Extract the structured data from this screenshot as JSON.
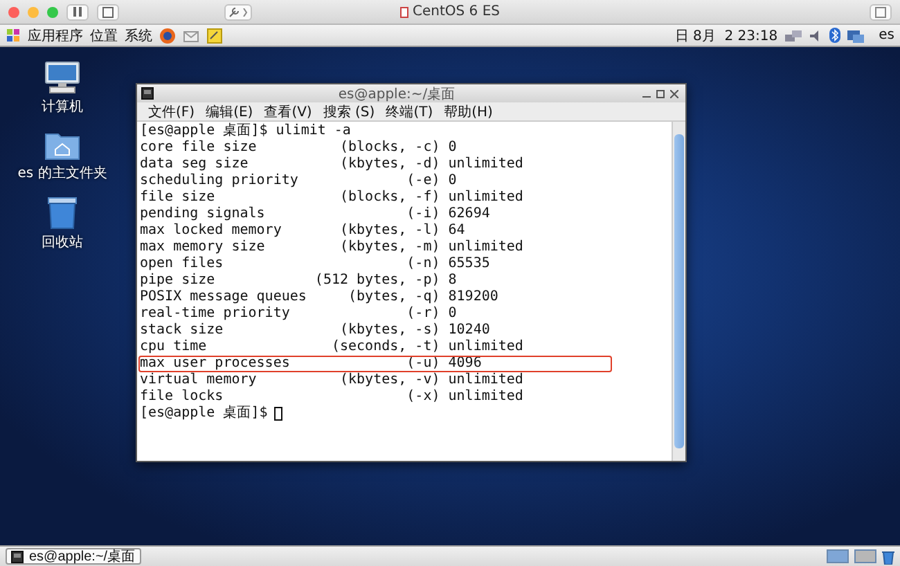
{
  "host_window": {
    "title": "CentOS 6 ES"
  },
  "top_panel": {
    "menus": [
      "应用程序",
      "位置",
      "系统"
    ],
    "clock": "日 8月  2 23:18",
    "user": "es"
  },
  "desktop_icons": [
    {
      "kind": "computer",
      "label": "计算机"
    },
    {
      "kind": "home",
      "label": "es 的主文件夹"
    },
    {
      "kind": "trash",
      "label": "回收站"
    }
  ],
  "terminal": {
    "title": "es@apple:~/桌面",
    "menus": [
      "文件(F)",
      "编辑(E)",
      "查看(V)",
      "搜索 (S)",
      "终端(T)",
      "帮助(H)"
    ],
    "lines": [
      {
        "text": "[es@apple 桌面]$ ulimit -a",
        "highlighted": false,
        "cursor": false
      },
      {
        "text": "core file size          (blocks, -c) 0",
        "highlighted": false,
        "cursor": false
      },
      {
        "text": "data seg size           (kbytes, -d) unlimited",
        "highlighted": false,
        "cursor": false
      },
      {
        "text": "scheduling priority             (-e) 0",
        "highlighted": false,
        "cursor": false
      },
      {
        "text": "file size               (blocks, -f) unlimited",
        "highlighted": false,
        "cursor": false
      },
      {
        "text": "pending signals                 (-i) 62694",
        "highlighted": false,
        "cursor": false
      },
      {
        "text": "max locked memory       (kbytes, -l) 64",
        "highlighted": false,
        "cursor": false
      },
      {
        "text": "max memory size         (kbytes, -m) unlimited",
        "highlighted": false,
        "cursor": false
      },
      {
        "text": "open files                      (-n) 65535",
        "highlighted": false,
        "cursor": false
      },
      {
        "text": "pipe size            (512 bytes, -p) 8",
        "highlighted": false,
        "cursor": false
      },
      {
        "text": "POSIX message queues     (bytes, -q) 819200",
        "highlighted": false,
        "cursor": false
      },
      {
        "text": "real-time priority              (-r) 0",
        "highlighted": false,
        "cursor": false
      },
      {
        "text": "stack size              (kbytes, -s) 10240",
        "highlighted": false,
        "cursor": false
      },
      {
        "text": "cpu time               (seconds, -t) unlimited",
        "highlighted": false,
        "cursor": false
      },
      {
        "text": "max user processes              (-u) 4096",
        "highlighted": true,
        "cursor": false
      },
      {
        "text": "virtual memory          (kbytes, -v) unlimited",
        "highlighted": false,
        "cursor": false
      },
      {
        "text": "file locks                      (-x) unlimited",
        "highlighted": false,
        "cursor": false
      },
      {
        "text": "[es@apple 桌面]$",
        "highlighted": false,
        "cursor": true
      }
    ]
  },
  "taskbar": {
    "items": [
      {
        "label": "es@apple:~/桌面",
        "selected": false
      }
    ],
    "workspaces": [
      {
        "selected": true
      },
      {
        "selected": false
      }
    ]
  }
}
